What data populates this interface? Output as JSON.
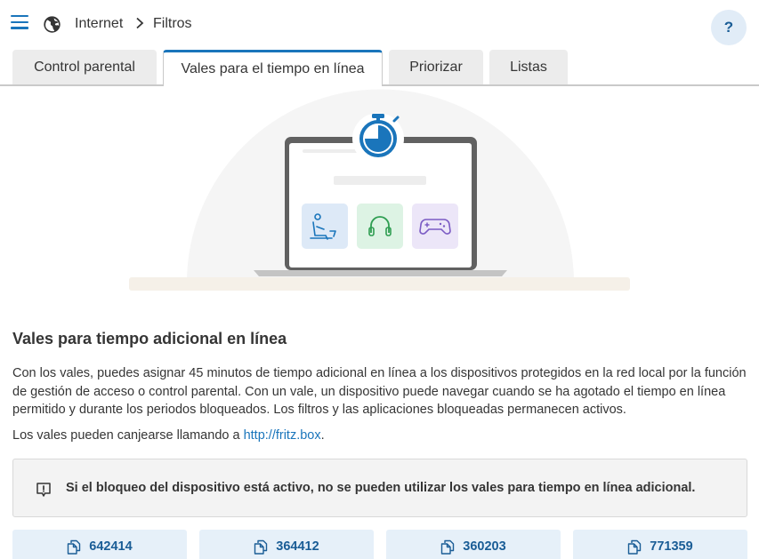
{
  "breadcrumb": {
    "root": "Internet",
    "current": "Filtros"
  },
  "help": {
    "label": "?"
  },
  "tabs": [
    {
      "label": "Control parental",
      "active": false
    },
    {
      "label": "Vales para el tiempo en línea",
      "active": true
    },
    {
      "label": "Priorizar",
      "active": false
    },
    {
      "label": "Listas",
      "active": false
    }
  ],
  "content": {
    "title": "Vales para tiempo adicional en línea",
    "description": "Con los vales, puedes asignar 45 minutos de tiempo adicional en línea a los dispositivos protegidos en la red local por la función de gestión de acceso o control parental. Con un vale, un dispositivo puede navegar cuando se ha agotado el tiempo en línea permitido y durante los periodos bloqueados. Los filtros y las aplicaciones bloqueadas permanecen activos.",
    "redeem_prefix": "Los vales pueden canjearse llamando a ",
    "redeem_link": "http://fritz.box",
    "redeem_suffix": "."
  },
  "notice": {
    "text": "Si el bloqueo del dispositivo está activo, no se pueden utilizar los vales para tiempo en línea adicional."
  },
  "vouchers": [
    "642414",
    "364412",
    "360203",
    "771359"
  ],
  "icons": {
    "menu": "hamburger-icon",
    "globe": "globe-icon",
    "separator": "chevron-right-icon",
    "notice": "alert-message-icon",
    "voucher": "copy-icon",
    "illustration": [
      "stopwatch-icon",
      "work-icon",
      "headphones-icon",
      "gamepad-icon"
    ]
  },
  "colors": {
    "accent": "#1a75bb",
    "voucher_bg": "#e6f0f9",
    "help_bg": "#e1ecf7"
  }
}
